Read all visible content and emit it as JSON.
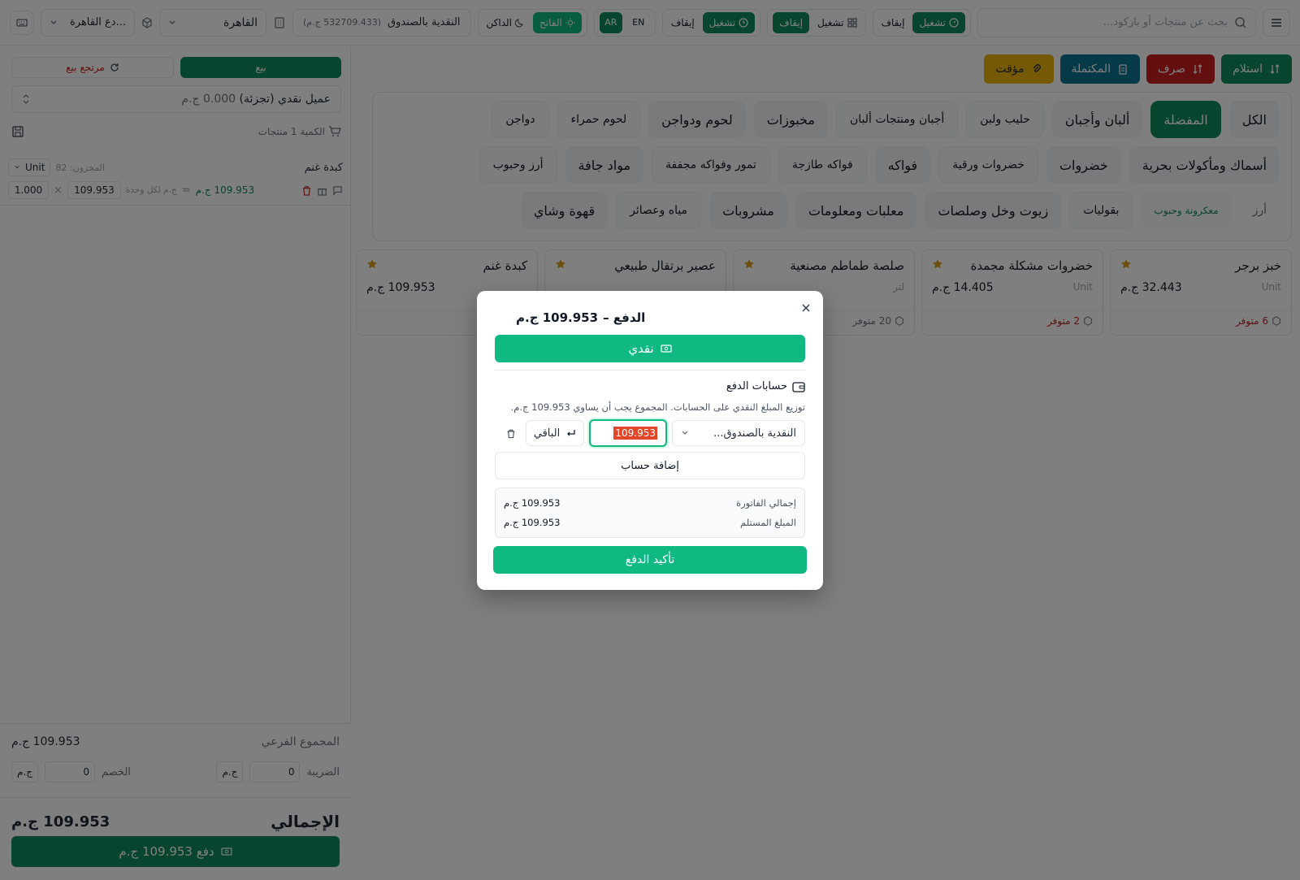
{
  "topbar": {
    "search_placeholder": "بحث عن منتجات أو باركود...",
    "shift1": {
      "run_label": "تشغيل",
      "stop_label": "إيقاف"
    },
    "shift2": {
      "run_label": "تشغيل",
      "stop_label": "إيقاف"
    },
    "shift3": {
      "run_label": "تشغيل",
      "stop_label": "إيقاف"
    },
    "lang_en": "EN",
    "lang_ar": "AR",
    "theme_light": "الفاتح",
    "theme_dark": "الداكن",
    "cashbox_name": "النقدية بالصندوق",
    "cashbox_balance": "(532709.433 ج.م)",
    "branch": "القاهرة",
    "warehouse": "...دع القاهرة"
  },
  "actions": {
    "receive": "استلام",
    "spend": "صرف",
    "completed": "المكتملة",
    "temporary": "مؤقت"
  },
  "categories": {
    "row1": [
      "الكل",
      "المفضلة",
      "ألبان وأجبان",
      "حليب ولبن",
      "أجبان ومنتجات ألبان",
      "مخبوزات",
      "لحوم ودواجن",
      "لحوم حمراء",
      "دواجن"
    ],
    "row2": [
      "أسماك ومأكولات بحرية",
      "خضروات",
      "خضروات ورقية",
      "فواكه",
      "فواكه طازجة",
      "تمور وفواكه مجففة",
      "مواد جافة",
      "أرز وحبوب"
    ],
    "row3": [
      "أرز",
      "معكرونة وحبوب",
      "بقوليات",
      "زيوت وخل وصلصات",
      "معلبات ومعلومات",
      "مشروبات",
      "مياه وعصائر",
      "قهوة وشاي"
    ]
  },
  "products": [
    {
      "name": "خبز برجر",
      "unit": "Unit",
      "price": "32.443 ج.م",
      "stock": "6 متوفر",
      "stock_color": "#c81e1e"
    },
    {
      "name": "خضروات مشكلة مجمدة",
      "unit": "Unit",
      "price": "14.405 ج.م",
      "stock": "2 متوفر",
      "stock_color": "#c81e1e"
    },
    {
      "name": "صلصة طماطم مصنعية",
      "unit": "لتر",
      "price": "",
      "stock": "20 متوفر",
      "stock_color": "#6b7280"
    },
    {
      "name": "عصير برتقال طبيعي",
      "unit": "",
      "price": "",
      "stock": "",
      "stock_color": "#6b7280"
    },
    {
      "name": "كبدة غنم",
      "unit": "",
      "price": "109.953 ج.م",
      "stock": "",
      "stock_color": "#6b7280"
    }
  ],
  "cart": {
    "sale_tab": "بيع",
    "return_tab": "مرتجع بيع",
    "customer": "عميل نقدي (تجزئة)",
    "customer_balance": "0.000 ج.م",
    "count_label": "الكمية 1 منتجات",
    "item": {
      "name": "كبدة غنم",
      "stock_label": "المخزون: 82",
      "unit": "Unit",
      "qty": "1.000",
      "times": "×",
      "unit_price": "109.953",
      "per_unit": "ج.م لكل وحدة",
      "equals": "=",
      "line_total": "109.953 ج.م"
    },
    "subtotal_label": "المجموع الفرعي",
    "subtotal_value": "109.953 ج.م",
    "tax_label": "الضريبة",
    "tax_value": "0",
    "discount_label": "الخصم",
    "discount_value": "0",
    "currency": "ج.م",
    "total_label": "الإجمالي",
    "total_value": "109.953 ج.م",
    "pay_button": "دفع 109.953 ج.م"
  },
  "modal": {
    "title_prefix": "الدفع –",
    "title_amount": "109.953 ج.م",
    "cash_button": "نقدي",
    "accounts_title": "حسابات الدفع",
    "hint": "توزيع المبلغ النقدي على الحسابات. المجموع يجب أن يساوي 109.953 ج.م.",
    "account_select": "النقدية بالصندوق...",
    "amount_value": "109.953",
    "remaining_button": "الباقي",
    "add_account": "إضافة حساب",
    "invoice_total_label": "إجمالي الفاتورة",
    "invoice_total_value": "109.953 ج.م",
    "received_label": "المبلغ المستلم",
    "received_value": "109.953 ج.م",
    "confirm_button": "تأكيد الدفع"
  },
  "colors": {
    "primary_dark": "#0f8a5f",
    "primary": "#10b981",
    "danger": "#c81e1e",
    "star": "#d4a017",
    "highlight": "#e2472a"
  }
}
